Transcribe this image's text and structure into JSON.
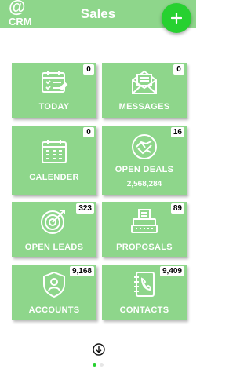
{
  "header": {
    "logo_symbol": "@",
    "logo_text": "CRM",
    "title": "Sales",
    "add_icon": "plus-icon"
  },
  "tiles": [
    {
      "label": "TODAY",
      "badge": "0",
      "icon": "calendar-checklist-icon"
    },
    {
      "label": "MESSAGES",
      "badge": "0",
      "icon": "mail-icon"
    },
    {
      "label": "CALENDER",
      "badge": "0",
      "icon": "calendar-icon"
    },
    {
      "label": "OPEN DEALS",
      "badge": "16",
      "sub": "2,568,284",
      "icon": "handshake-icon"
    },
    {
      "label": "OPEN LEADS",
      "badge": "323",
      "icon": "target-icon"
    },
    {
      "label": "PROPOSALS",
      "badge": "89",
      "icon": "typewriter-icon"
    },
    {
      "label": "ACCOUNTS",
      "badge": "9,168",
      "icon": "shield-user-icon"
    },
    {
      "label": "CONTACTS",
      "badge": "9,409",
      "icon": "phone-book-icon"
    }
  ],
  "pager": {
    "pages": 2,
    "active": 1
  },
  "colors": {
    "header": "#8ed68b",
    "tile": "#8ed68b",
    "fab": "#27d130",
    "dot_active": "#27d130",
    "dot_inactive": "#e6e6e6"
  }
}
